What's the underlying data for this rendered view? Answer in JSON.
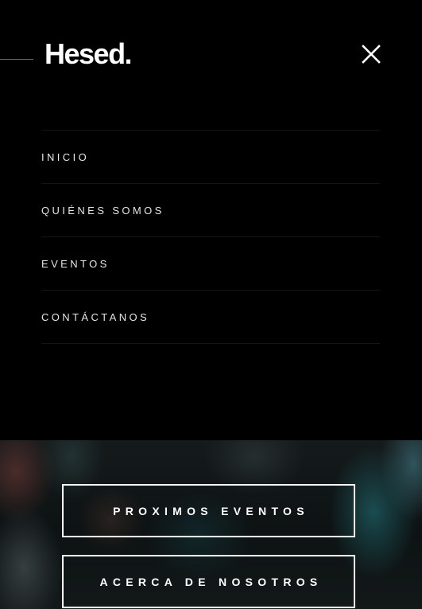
{
  "logo": {
    "text": "Hesed."
  },
  "menu": {
    "close_icon": "close-icon",
    "items": [
      {
        "label": "INICIO"
      },
      {
        "label": "QUIÉNES SOMOS"
      },
      {
        "label": "EVENTOS"
      },
      {
        "label": "CONTÁCTANOS"
      }
    ]
  },
  "hero": {
    "buttons": [
      {
        "label": "PROXIMOS EVENTOS"
      },
      {
        "label": "ACERCA DE NOSOTROS"
      }
    ]
  },
  "colors": {
    "background": "#000000",
    "text": "#ffffff",
    "nav_text": "#e6e6e6",
    "divider": "#141414"
  }
}
